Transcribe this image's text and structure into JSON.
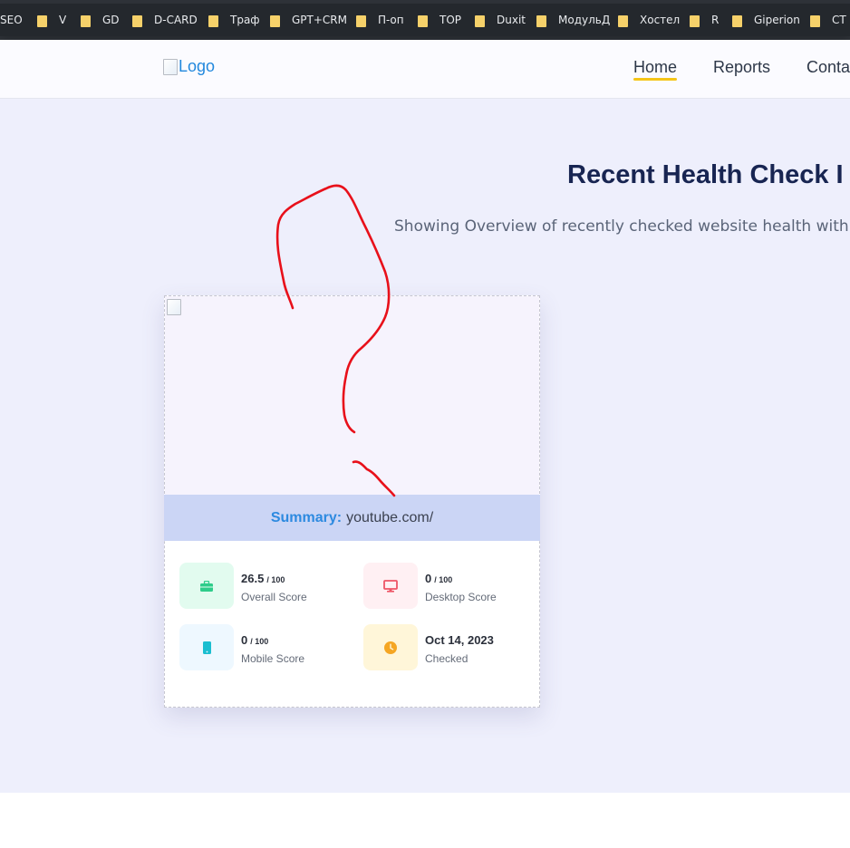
{
  "bookmarks": [
    {
      "label": "SEO",
      "folder": false
    },
    {
      "label": "V",
      "folder": true
    },
    {
      "label": "GD",
      "folder": true
    },
    {
      "label": "D-CARD",
      "folder": true
    },
    {
      "label": "Траф",
      "folder": true
    },
    {
      "label": "GPT+CRM",
      "folder": true
    },
    {
      "label": "П-оп",
      "folder": true
    },
    {
      "label": "TOP",
      "folder": true
    },
    {
      "label": "Duxit",
      "folder": true
    },
    {
      "label": "МодульД",
      "folder": true
    },
    {
      "label": "Хостел",
      "folder": true
    },
    {
      "label": "R",
      "folder": true
    },
    {
      "label": "Giperion",
      "folder": true
    },
    {
      "label": "CT",
      "folder": true
    }
  ],
  "header": {
    "logo_alt": "Logo",
    "nav": {
      "home": "Home",
      "reports": "Reports",
      "contact": "Conta"
    }
  },
  "hero": {
    "title": "Recent Health Check I",
    "subtitle": "Showing Overview of recently checked website health with s"
  },
  "card": {
    "summary_label": "Summary:",
    "summary_value": "youtube.com/",
    "stats": [
      {
        "value": "26.5",
        "suffix": "/ 100",
        "label": "Overall Score",
        "icon": "briefcase-icon",
        "color": "#2ecc8a"
      },
      {
        "value": "0",
        "suffix": "/ 100",
        "label": "Desktop Score",
        "icon": "desktop-icon",
        "color": "#ee5566"
      },
      {
        "value": "0",
        "suffix": "/ 100",
        "label": "Mobile Score",
        "icon": "mobile-icon",
        "color": "#1bbed0"
      },
      {
        "value": "Oct 14, 2023",
        "suffix": "",
        "label": "Checked",
        "icon": "clock-icon",
        "color": "#f5a623"
      }
    ]
  },
  "colors": {
    "accent_blue": "#2d8ae0",
    "nav_underline": "#f5c518",
    "title": "#182552",
    "annotation": "#e8101a"
  }
}
